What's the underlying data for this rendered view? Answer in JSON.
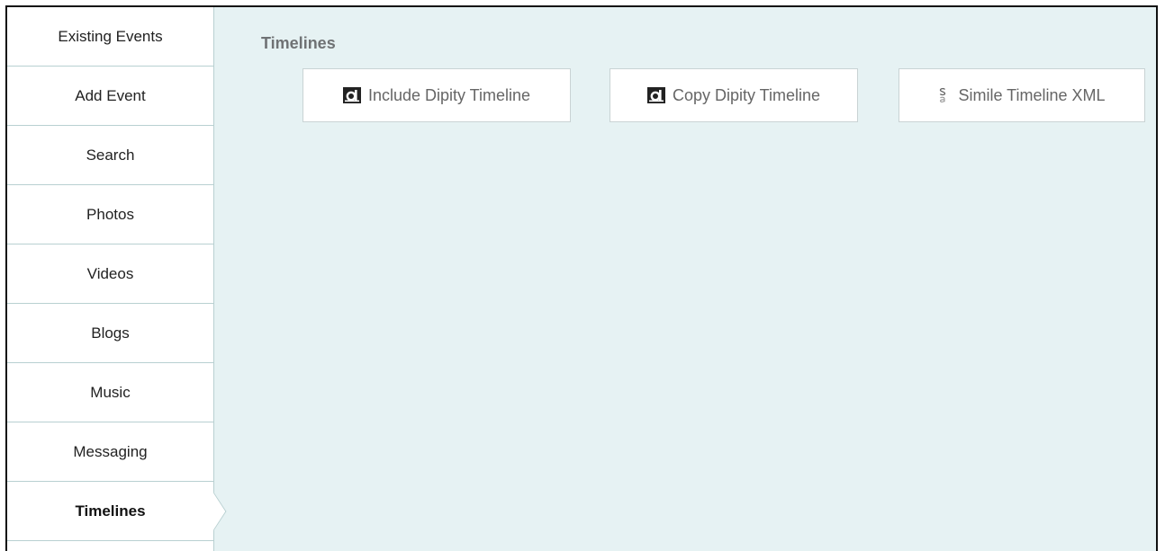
{
  "sidebar": {
    "items": [
      {
        "label": "Existing Events"
      },
      {
        "label": "Add Event"
      },
      {
        "label": "Search"
      },
      {
        "label": "Photos"
      },
      {
        "label": "Videos"
      },
      {
        "label": "Blogs"
      },
      {
        "label": "Music"
      },
      {
        "label": "Messaging"
      },
      {
        "label": "Timelines",
        "active": true
      }
    ]
  },
  "main": {
    "title": "Timelines",
    "buttons": [
      {
        "label": "Include Dipity Timeline",
        "icon": "dipity-icon"
      },
      {
        "label": "Copy Dipity Timeline",
        "icon": "dipity-icon"
      },
      {
        "label": "Simile Timeline XML",
        "icon": "simile-icon"
      }
    ]
  },
  "colors": {
    "content_bg": "#e6f2f3",
    "tab_border": "#b8d0d1",
    "title_text": "#6f7274",
    "button_text": "#666666"
  }
}
